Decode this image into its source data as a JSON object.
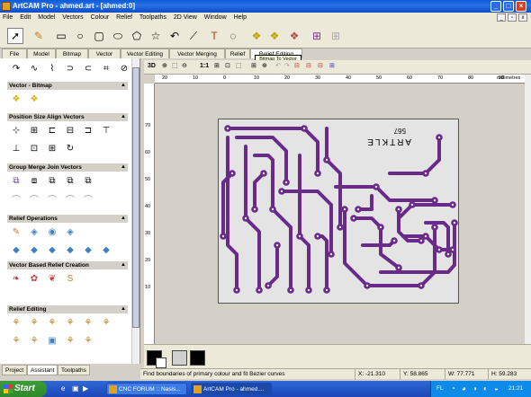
{
  "window": {
    "title": "ArtCAM Pro - ahmed.art - [ahmed:0]"
  },
  "menu": [
    "File",
    "Edit",
    "Model",
    "Vectors",
    "Colour",
    "Relief",
    "Toolpaths",
    "2D View",
    "Window",
    "Help"
  ],
  "tabs": [
    "File",
    "Model",
    "Bitmap",
    "Vector",
    "Vector Editing",
    "Vector Merging",
    "Relief",
    "Relief Editing"
  ],
  "active_tab": "Relief Editing",
  "tooltip": "Bitmap To Vector",
  "panel": {
    "sections": [
      "Vector - Bitmap",
      "Position Size Align Vectors",
      "Group Merge Join Vectors",
      "Relief Operations",
      "Vector Based Relief Creation",
      "Relief Editing"
    ]
  },
  "bottom_tabs": [
    "Project",
    "Assistant",
    "Toolpaths"
  ],
  "active_bottom_tab": "Assistant",
  "view_toolbar": {
    "mode_3d": "3D",
    "zoom_11": "1:1",
    "units": "millimetres"
  },
  "ruler_h": [
    "20",
    "10",
    "0",
    "10",
    "20",
    "30",
    "40",
    "50",
    "60",
    "70",
    "80",
    "90"
  ],
  "ruler_v": [
    "70",
    "60",
    "50",
    "40",
    "30",
    "20",
    "10"
  ],
  "board_text": [
    "ARTKLE",
    "567"
  ],
  "status": {
    "message": "Find boundaries of primary colour and fit Bezier curves",
    "x": "X: -21.310",
    "y": "Y: 58.865",
    "w": "W: 77.771",
    "h": "H: 59.283"
  },
  "taskbar": {
    "start": "Start",
    "tasks": [
      "CNC FORUM :: Nasis...",
      "ArtCAM Pro - ahmed...."
    ],
    "lang": "FL",
    "clock": "21:21"
  },
  "colors": {
    "title_bar": "#0a5ad8",
    "trace": "#6a2a8a",
    "board": "#e4e4e4",
    "swatch_primary": "#000000",
    "swatch_secondary": "#d0d0d0"
  }
}
